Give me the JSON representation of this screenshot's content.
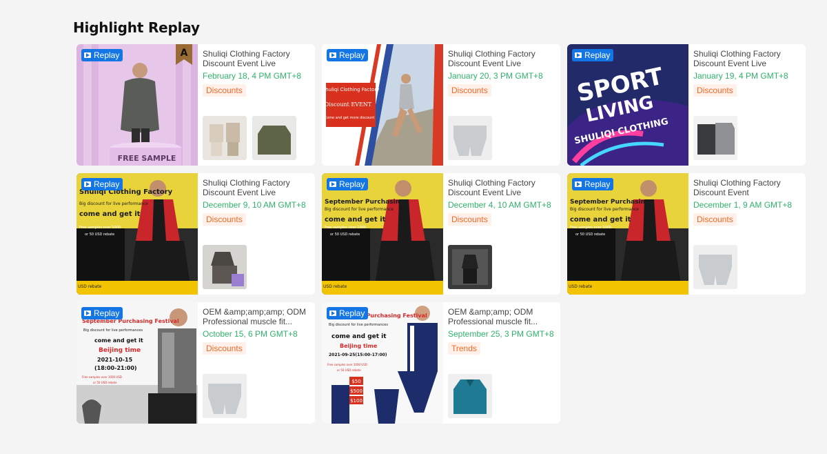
{
  "section": {
    "title": "Highlight Replay"
  },
  "replay_label": "Replay",
  "cards": [
    {
      "title": "Shuliqi Clothing Factory Discount Event Live",
      "time": "February 18, 4 PM GMT+8",
      "tag": "Discounts",
      "thumb_text": [
        "FREE SAMPLE"
      ]
    },
    {
      "title": "Shuliqi Clothing Factory Discount Event Live",
      "time": "January 20, 3 PM GMT+8",
      "tag": "Discounts",
      "thumb_text": [
        "Shuliqi Clothing Factory",
        "Discount EVENT",
        "Come and get more discount"
      ]
    },
    {
      "title": "Shuliqi Clothing Factory Discount Event Live",
      "time": "January 19, 4 PM GMT+8",
      "tag": "Discounts",
      "thumb_text": [
        "SPORT",
        "LIVING",
        "SHULIQI CLOTHING"
      ]
    },
    {
      "title": "Shuliqi Clothing Factory Discount Event Live",
      "time": "December 9, 10 AM GMT+8",
      "tag": "Discounts",
      "thumb_text": [
        "Shuliqi Clothing Factory",
        "Big discount for live performance",
        "come and get it",
        "Free samples over 1000",
        "or 50 USD rebate",
        "USD rebate"
      ]
    },
    {
      "title": "Shuliqi Clothing Factory Discount Event Live",
      "time": "December 4, 10 AM GMT+8",
      "tag": "Discounts",
      "thumb_text": [
        "September Purchasing",
        "Big discount for live performance",
        "come and get it",
        "Free samples over 1000",
        "or 50 USD rebate",
        "USD rebate"
      ]
    },
    {
      "title": "Shuliqi Clothing Factory Discount Event",
      "time": "December 1, 9 AM GMT+8",
      "tag": "Discounts",
      "thumb_text": [
        "September Purchasing",
        "Big discount for live performance",
        "come and get it",
        "Free samples over 1000",
        "or 50 USD rebate",
        "USD rebate"
      ]
    },
    {
      "title": "OEM &amp;amp;amp; ODM Professional muscle fit...",
      "time": "October 15, 6 PM GMT+8",
      "tag": "Discounts",
      "thumb_text": [
        "September Purchasing Festival",
        "Big discount for live performances",
        "come and get it",
        "Beijing time",
        "2021-10-15",
        "(18:00-21:00)",
        "Free samples over 1000 USD",
        "or 50 USD rebate"
      ]
    },
    {
      "title": "OEM &amp;amp; ODM Professional muscle fit...",
      "time": "September 25, 3 PM GMT+8",
      "tag": "Trends",
      "thumb_text": [
        "September Purchasing Festival",
        "Big discount for live performances",
        "come and get it",
        "Beijing time",
        "2021-09-25(15:00-17:00)",
        "Free samples over 1000 USD",
        "or 50 USD rebate",
        "$50",
        "$500",
        "$100"
      ]
    }
  ],
  "colors": {
    "replay_badge": "#1476e5",
    "time_text": "#2fb36a",
    "tag_text": "#f06a27",
    "tag_bg": "#fff1ea"
  }
}
